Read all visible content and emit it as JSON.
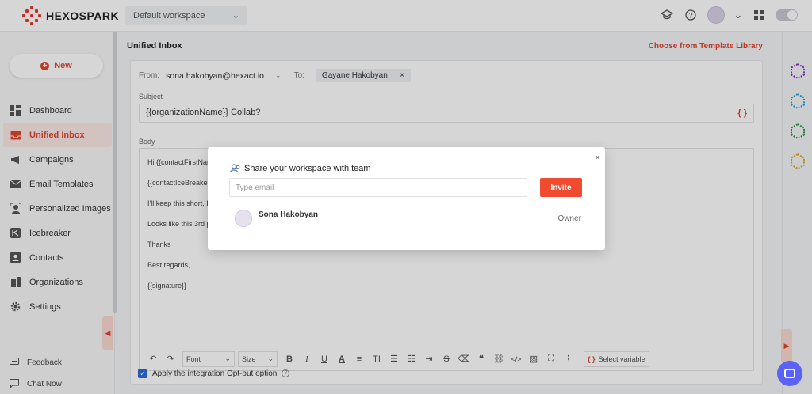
{
  "app": {
    "name": "HEXOSPARK",
    "brand_color": "#e2452f"
  },
  "header": {
    "workspace_selected": "Default workspace"
  },
  "sidebar": {
    "new_label": "New",
    "items": [
      {
        "label": "Dashboard",
        "icon": "dashboard-icon",
        "active": false
      },
      {
        "label": "Unified Inbox",
        "icon": "inbox-icon",
        "active": true
      },
      {
        "label": "Campaigns",
        "icon": "megaphone-icon",
        "active": false
      },
      {
        "label": "Email Templates",
        "icon": "envelope-icon",
        "active": false
      },
      {
        "label": "Personalized Images",
        "icon": "person-image-icon",
        "active": false
      },
      {
        "label": "Icebreaker",
        "icon": "icebreaker-icon",
        "active": false
      },
      {
        "label": "Contacts",
        "icon": "contacts-icon",
        "active": false
      },
      {
        "label": "Organizations",
        "icon": "organizations-icon",
        "active": false
      },
      {
        "label": "Settings",
        "icon": "gear-icon",
        "active": false
      }
    ],
    "feedback": "Feedback",
    "chat_now": "Chat Now"
  },
  "main": {
    "title": "Unified Inbox",
    "template_link": "Choose from Template Library",
    "from_label": "From:",
    "from_value": "sona.hakobyan@hexact.io",
    "to_label": "To:",
    "to_value": "Gayane Hakobyan",
    "subject_label": "Subject",
    "subject_value": "{{organizationName}} Collab?",
    "variable_symbol": "{ }",
    "body_label": "Body",
    "body_lines": [
      "Hi {{contactFirstNam",
      "{{contactIceBreaker",
      "I'll keep this short, I",
      "Looks like this 3rd p",
      "Thanks",
      "Best regards,",
      "{{signature}}"
    ],
    "toolbar": {
      "font": "Font",
      "size": "Size",
      "select_variable": "Select variable"
    },
    "optout_label": "Apply the integration Opt-out option"
  },
  "modal": {
    "title": "Share your workspace with team",
    "email_placeholder": "Type email",
    "invite_label": "Invite",
    "member_name": "Sona Hakobyan",
    "member_role": "Owner"
  }
}
